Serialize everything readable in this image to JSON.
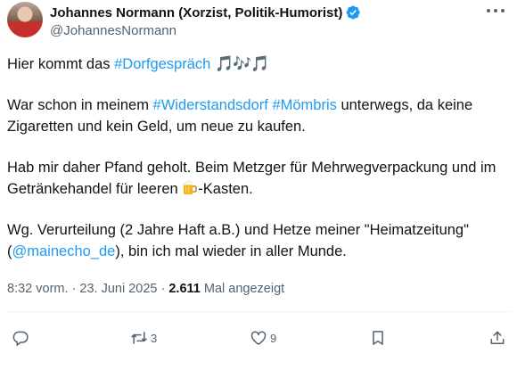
{
  "author": {
    "name": "Johannes Normann (Xorzist, Politik-Humorist)",
    "handle": "@JohannesNormann"
  },
  "icons": {
    "avatar": "profile-photo",
    "verified": "verified-badge-icon",
    "more": "more-options-icon",
    "music": "musical-notes-emoji",
    "beer": "beer-mug-emoji",
    "reply": "reply-icon",
    "repost": "repost-icon",
    "like": "heart-icon",
    "bookmark": "bookmark-icon",
    "share": "share-icon"
  },
  "colors": {
    "link": "#1d9bf0",
    "muted": "#536471",
    "text": "#0f1419"
  },
  "post": {
    "line1_prefix": "Hier kommt das ",
    "line1_hashtag": "#Dorfgespräch",
    "line1_emoji": "🎵🎶🎵",
    "p2_prefix": "War schon in meinem ",
    "p2_hashtag1": "#Widerstandsdorf",
    "p2_space": " ",
    "p2_hashtag2": "#Mömbris",
    "p2_suffix": " unterwegs, da keine Zigaretten und kein Geld, um neue zu kaufen.",
    "p3_prefix": "Hab mir daher Pfand geholt. Beim Metzger für Mehrwegverpackung und im Getränkehandel für leeren ",
    "p3_suffix": "-Kasten.",
    "p4_prefix": "Wg. Verurteilung (2 Jahre Haft a.B.) und Hetze meiner \"Heimatzeitung\" (",
    "p4_mention": "@mainecho_de",
    "p4_suffix": "), bin ich mal wieder in aller Munde."
  },
  "meta": {
    "time": "8:32 vorm.",
    "sep": " · ",
    "date": "23. Juni 2025",
    "sep2": " · ",
    "views": "2.611",
    "views_label": " Mal angezeigt"
  },
  "actions": {
    "reposts": "3",
    "likes": "9"
  }
}
